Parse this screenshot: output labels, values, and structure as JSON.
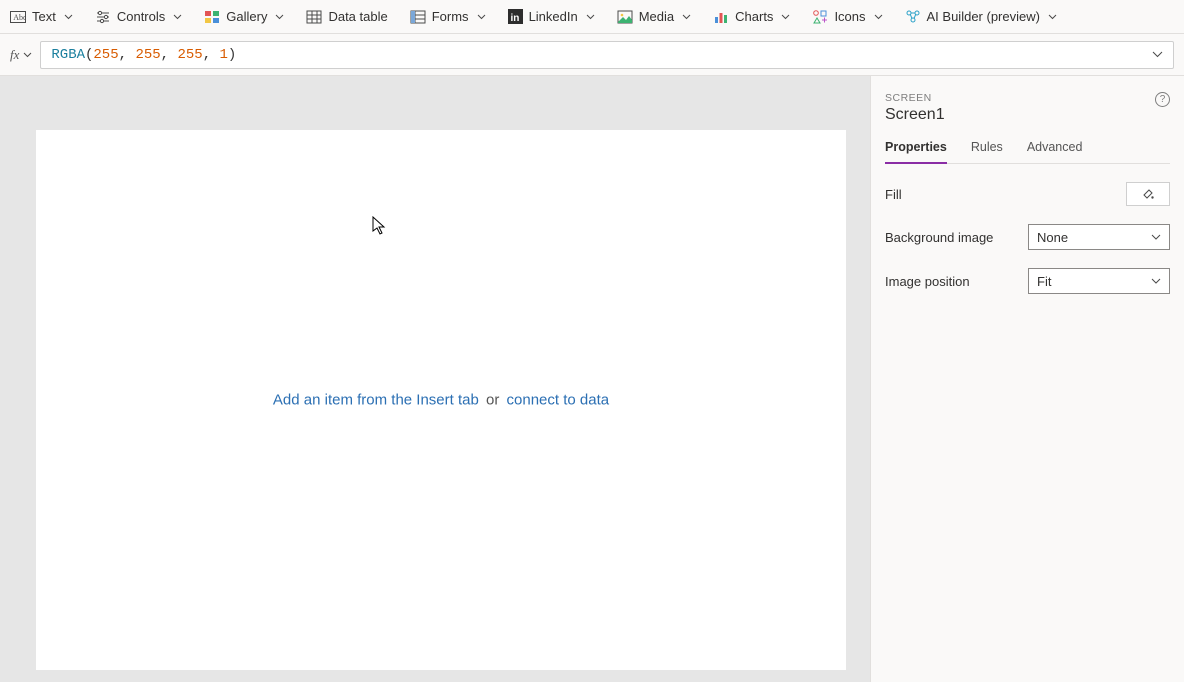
{
  "ribbon": [
    {
      "label": "Text"
    },
    {
      "label": "Controls"
    },
    {
      "label": "Gallery"
    },
    {
      "label": "Data table"
    },
    {
      "label": "Forms"
    },
    {
      "label": "LinkedIn"
    },
    {
      "label": "Media"
    },
    {
      "label": "Charts"
    },
    {
      "label": "Icons"
    },
    {
      "label": "AI Builder (preview)"
    }
  ],
  "formula": {
    "fn": "RGBA",
    "args": [
      "255",
      "255",
      "255",
      "1"
    ]
  },
  "canvas": {
    "prefixLink": "Add an item from the Insert tab",
    "middle": "or",
    "suffixLink": "connect to data"
  },
  "panel": {
    "section": "SCREEN",
    "title": "Screen1",
    "tabs": [
      "Properties",
      "Rules",
      "Advanced"
    ],
    "activeTab": 0,
    "props": {
      "fillLabel": "Fill",
      "bgLabel": "Background image",
      "bgValue": "None",
      "imgPosLabel": "Image position",
      "imgPosValue": "Fit"
    }
  }
}
